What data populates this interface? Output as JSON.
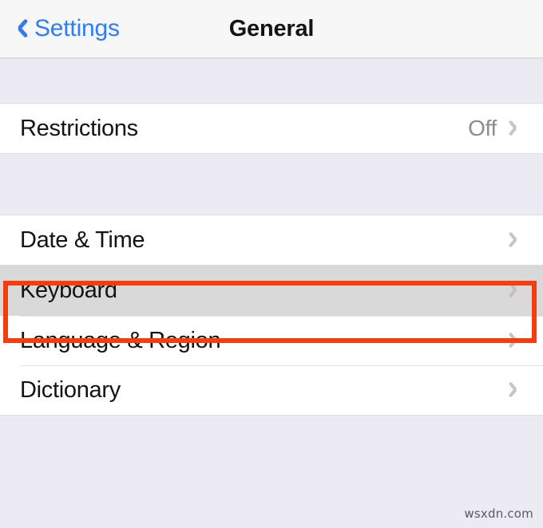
{
  "navbar": {
    "back_label": "Settings",
    "back_icon": "chevron-left-icon",
    "title": "General"
  },
  "colors": {
    "accent_blue": "#2E7DF6",
    "highlight_red": "#F63D0D",
    "row_selected_bg": "#D9D9D9",
    "section_gap_bg": "#ECEAF3",
    "value_gray": "#8C8C91",
    "chevron_gray": "#C4C4C9"
  },
  "sections": [
    {
      "rows": [
        {
          "label": "Restrictions",
          "value": "Off",
          "accessory": "chevron-right-icon",
          "highlighted": false
        }
      ]
    },
    {
      "rows": [
        {
          "label": "Date & Time",
          "value": "",
          "accessory": "chevron-right-icon",
          "highlighted": false
        },
        {
          "label": "Keyboard",
          "value": "",
          "accessory": "chevron-right-icon",
          "highlighted": true
        },
        {
          "label": "Language & Region",
          "value": "",
          "accessory": "chevron-right-icon",
          "highlighted": false
        },
        {
          "label": "Dictionary",
          "value": "",
          "accessory": "chevron-right-icon",
          "highlighted": false
        }
      ]
    }
  ],
  "watermark": "wsxdn.com"
}
